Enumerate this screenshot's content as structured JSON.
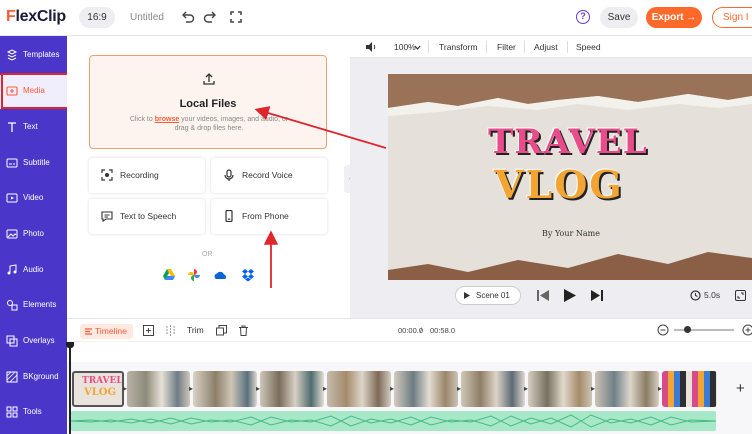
{
  "header": {
    "logo": "FlexClip",
    "ratio": "16:9",
    "project_name": "Untitled",
    "save_label": "Save",
    "export_label": "Export →",
    "signin_label": "Sign I",
    "help_label": "?"
  },
  "sidebar": {
    "items": [
      {
        "label": "Templates",
        "icon": "templates-icon"
      },
      {
        "label": "Media",
        "icon": "media-icon"
      },
      {
        "label": "Text",
        "icon": "text-icon"
      },
      {
        "label": "Subtitle",
        "icon": "subtitle-icon"
      },
      {
        "label": "Video",
        "icon": "video-icon"
      },
      {
        "label": "Photo",
        "icon": "photo-icon"
      },
      {
        "label": "Audio",
        "icon": "audio-icon"
      },
      {
        "label": "Elements",
        "icon": "elements-icon"
      },
      {
        "label": "Overlays",
        "icon": "overlays-icon"
      },
      {
        "label": "BKground",
        "icon": "background-icon"
      },
      {
        "label": "Tools",
        "icon": "tools-icon"
      }
    ],
    "active": "Media"
  },
  "media_panel": {
    "local_files_title": "Local Files",
    "local_files_desc_pre": "Click to ",
    "local_files_browse": "browse",
    "local_files_desc_post": " your videos, images, and audio, or drag & drop files here.",
    "options": {
      "recording": "Recording",
      "record_voice": "Record Voice",
      "text_to_speech": "Text to Speech",
      "from_phone": "From Phone"
    },
    "or_label": "OR",
    "cloud_sources": [
      "google-drive-icon",
      "google-photos-icon",
      "onedrive-icon",
      "dropbox-icon"
    ]
  },
  "preview_toolbar": {
    "zoom": "100%",
    "transform": "Transform",
    "filter": "Filter",
    "adjust": "Adjust",
    "speed": "Speed"
  },
  "canvas": {
    "title_line1": "TRAVEL",
    "title_line2": "VLOG",
    "byline": "By Your Name"
  },
  "playback": {
    "scene_label": "Scene  01",
    "duration": "5.0s"
  },
  "timeline": {
    "label": "Timeline",
    "trim_label": "Trim",
    "current_time": "00:00.0",
    "total_time": "00:58.0",
    "time_separator": "/",
    "clip_count": 9,
    "add_label": "+"
  },
  "colors": {
    "sidebar": "#4a37c9",
    "accent": "#ff6a2b",
    "annotation": "#e0252e",
    "audio_track": "#a7e8c8"
  }
}
